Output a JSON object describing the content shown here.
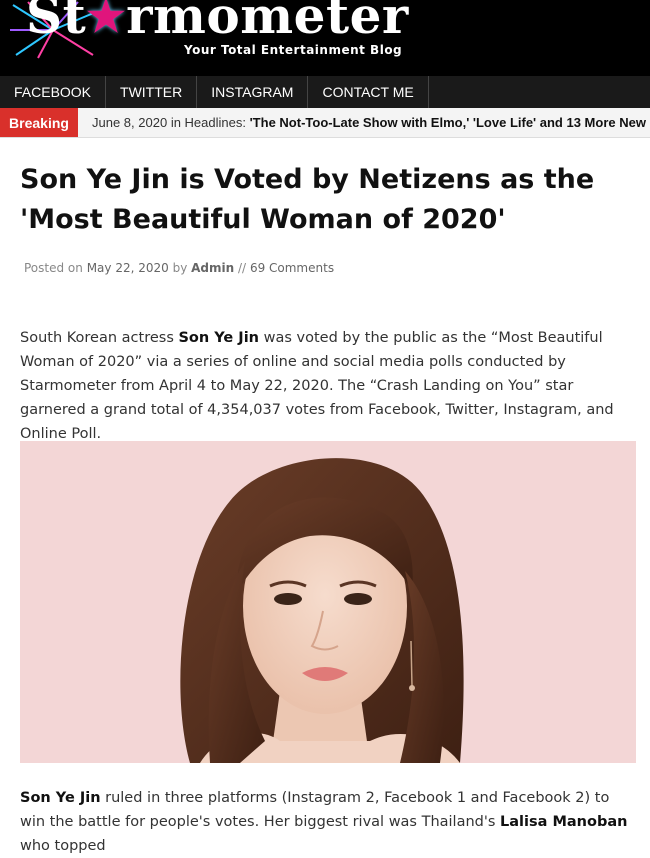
{
  "site": {
    "logo_prefix": "St",
    "logo_suffix": "rmometer",
    "tagline": "Your Total Entertainment Blog"
  },
  "nav": {
    "items": [
      "FACEBOOK",
      "TWITTER",
      "INSTAGRAM",
      "CONTACT ME"
    ]
  },
  "breaking": {
    "label": "Breaking",
    "date": "June 8, 2020",
    "in_text": "in Headlines:",
    "headline": "'The Not-Too-Late Show with Elmo,' 'Love Life' and 13 More New"
  },
  "article": {
    "title": "Son Ye Jin is Voted by Netizens as the 'Most Beautiful Woman of 2020'",
    "meta": {
      "posted_on": "Posted on",
      "date": "May 22, 2020",
      "by": "by",
      "author": "Admin",
      "separator": "//",
      "comments": "69 Comments"
    },
    "p1": {
      "a": "South Korean actress ",
      "name": "Son Ye Jin",
      "b": " was voted by the public as the “Most Beautiful Woman of 2020” via a series of online and social media polls conducted by Starmometer from April 4 to May 22, 2020. The “Crash Landing on You” star garnered a grand total of 4,354,037 votes from Facebook, Twitter, Instagram, and Online Poll."
    },
    "p2": {
      "name": "Son Ye Jin",
      "a": " ruled in three platforms (Instagram 2, Facebook 1 and Facebook 2) to win the battle for people's votes. Her biggest rival was Thailand's ",
      "rival": "Lalisa Manoban",
      "b": " who topped"
    }
  },
  "colors": {
    "header_bg": "#000000",
    "nav_bg": "#1a1a1a",
    "breaking_red": "#d9302b",
    "logo_star": "#e0157c",
    "photo_bg": "#f3d4d4"
  }
}
